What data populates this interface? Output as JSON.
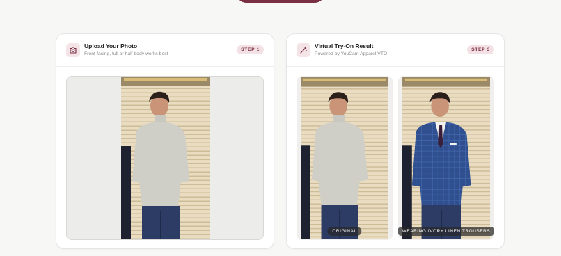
{
  "upload_card": {
    "icon": "camera-icon",
    "title": "Upload Your Photo",
    "subtitle": "Front-facing, full or half body works best",
    "step": "STEP 1"
  },
  "result_card": {
    "icon": "magic-wand-icon",
    "title": "Virtual Try-On Result",
    "subtitle": "Powered by YouCam Apparel VTO",
    "step": "STEP 3",
    "original_caption": "ORIGINAL",
    "result_caption": "WEARING IVORY LINEN TROUSERS"
  },
  "colors": {
    "accent": "#7a2e42",
    "badge_bg": "#f4e1e5",
    "page_bg": "#f7f7f6"
  }
}
